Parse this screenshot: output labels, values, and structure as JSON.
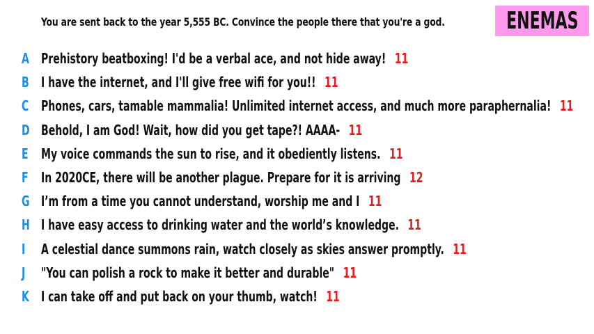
{
  "prompt": "You are sent back to the year 5,555 BC. Convince the people there that you're a god.",
  "badge": {
    "text": "ENEMAS",
    "color": "#ff99ee"
  },
  "colors": {
    "letter": "#1a8fe6",
    "score": "#e21c1c",
    "text": "#111111"
  },
  "answers": [
    {
      "letter": "A",
      "text": "Prehistory beatboxing! I'd be a verbal ace, and not hide away!",
      "score": "11"
    },
    {
      "letter": "B",
      "text": "I have the internet, and I'll give free wifi for you!!",
      "score": "11"
    },
    {
      "letter": "C",
      "text": "Phones, cars, tamable mammalia! Unlimited internet access, and much more paraphernalia!",
      "score": "11"
    },
    {
      "letter": "D",
      "text": "Behold, I am God! Wait, how did you get tape?! AAAA-",
      "score": "11"
    },
    {
      "letter": "E",
      "text": "My voice commands the sun to rise, and it obediently listens.",
      "score": "11"
    },
    {
      "letter": "F",
      "text": "In 2020CE, there will be another plague. Prepare for it is arriving",
      "score": "12"
    },
    {
      "letter": "G",
      "text": "I’m from a time you cannot understand, worship me and I",
      "score": "11"
    },
    {
      "letter": "H",
      "text": "I have easy access to drinking water and the world’s knowledge.",
      "score": "11"
    },
    {
      "letter": "I",
      "text": "A celestial dance summons rain, watch closely as skies answer promptly.",
      "score": "11"
    },
    {
      "letter": "J",
      "text": "\"You can polish a rock to make it better and durable\"",
      "score": "11"
    },
    {
      "letter": "K",
      "text": "I can take off and put back on your thumb, watch!",
      "score": "11"
    }
  ]
}
